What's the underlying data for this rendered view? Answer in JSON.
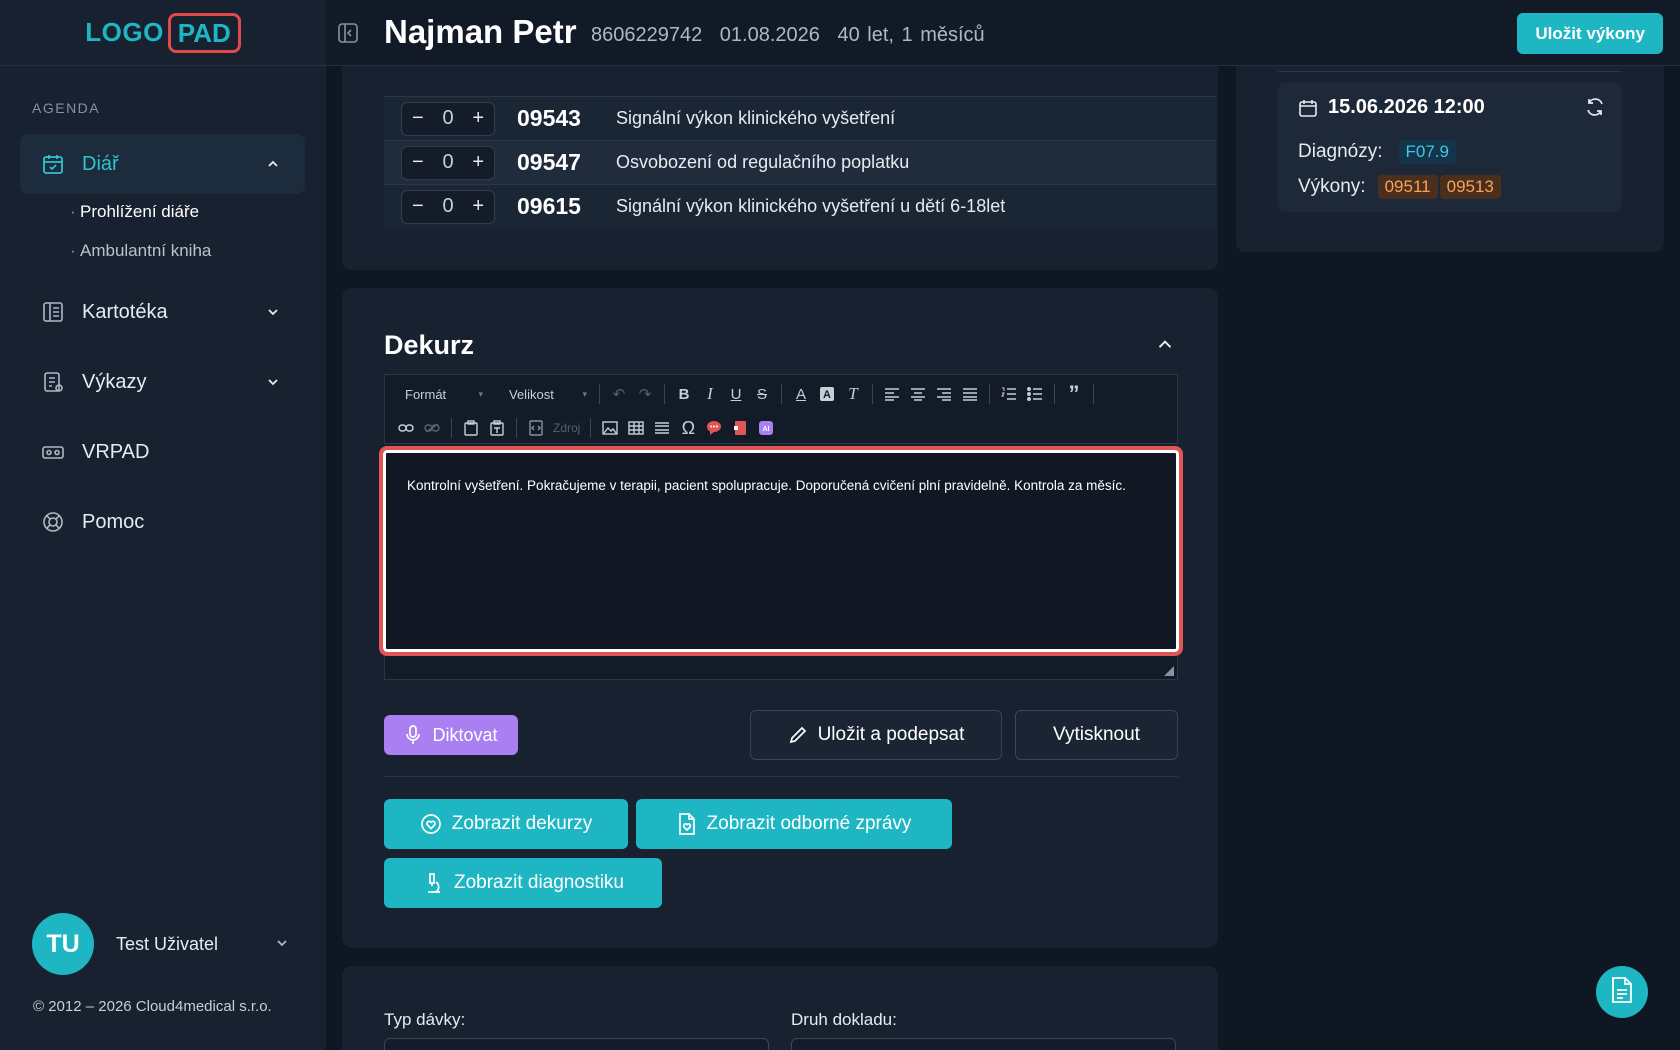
{
  "logo": {
    "left": "LOGO",
    "right": "PAD"
  },
  "sidebar": {
    "section_label": "AGENDA",
    "items": [
      {
        "label": "Diář",
        "icon": "calendar-check-icon",
        "active": true
      },
      {
        "label": "Kartotéka",
        "icon": "book-icon"
      },
      {
        "label": "Výkazy",
        "icon": "report-icon"
      },
      {
        "label": "VRPAD",
        "icon": "vr-headset-icon"
      },
      {
        "label": "Pomoc",
        "icon": "lifebuoy-icon"
      }
    ],
    "sub_items": [
      {
        "label": "Prohlížení diáře",
        "current": true
      },
      {
        "label": "Ambulantní kniha"
      }
    ],
    "user": {
      "initials": "TU",
      "name": "Test Uživatel"
    },
    "copyright": "© 2012 – 2026 Cloud4medical s.r.o."
  },
  "header": {
    "patient_name": "Najman Petr",
    "patient_id": "8606229742",
    "date": "01.08.2026",
    "age": "40 let, 1 měsíců",
    "save_button": "Uložit výkony"
  },
  "procedures": [
    {
      "count": "0",
      "code": "09543",
      "description": "Signální výkon klinického vyšetření"
    },
    {
      "count": "0",
      "code": "09547",
      "description": "Osvobození od regulačního poplatku"
    },
    {
      "count": "0",
      "code": "09615",
      "description": "Signální výkon klinického vyšetření u dětí 6-18let"
    }
  ],
  "dekurz": {
    "title": "Dekurz",
    "toolbar": {
      "format_label": "Formát",
      "size_label": "Velikost",
      "source_label": "Zdroj"
    },
    "text": "Kontrolní vyšetření. Pokračujeme v terapii, pacient spolupracuje. Doporučená cvičení plní pravidelně. Kontrola za měsíc.",
    "buttons": {
      "dictate": "Diktovat",
      "sign": "Uložit a podepsat",
      "print": "Vytisknout",
      "show_dekurzy": "Zobrazit dekurzy",
      "show_reports": "Zobrazit odborné zprávy",
      "show_diagnostics": "Zobrazit diagnostiku"
    }
  },
  "bottom_form": {
    "batch_type_label": "Typ dávky:",
    "doc_type_label": "Druh dokladu:"
  },
  "visit": {
    "datetime": "15.06.2026 12:00",
    "diagnoses_label": "Diagnózy:",
    "diagnoses": [
      "F07.9"
    ],
    "procedures_label": "Výkony:",
    "procedures": [
      "09511",
      "09513"
    ]
  },
  "colors": {
    "accent": "#1fb6c3",
    "highlight": "#e25555",
    "dictate": "#a97ff2"
  }
}
